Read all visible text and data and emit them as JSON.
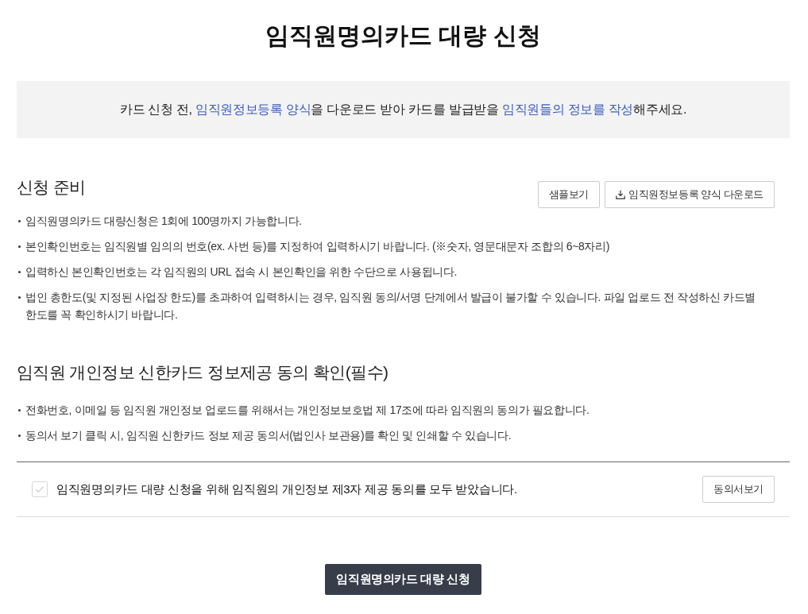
{
  "page_title": "임직원명의카드 대량 신청",
  "notice": {
    "segments": [
      {
        "text": "카드 신청 전, ",
        "highlighted": false
      },
      {
        "text": "임직원정보등록 양식",
        "highlighted": true
      },
      {
        "text": "을 다운로드 받아 카드를 발급받을 ",
        "highlighted": false
      },
      {
        "text": "임직원들의 정보를 작성",
        "highlighted": true
      },
      {
        "text": "해주세요.",
        "highlighted": false
      }
    ]
  },
  "sections": [
    {
      "heading": "신청 준비",
      "buttons": [
        {
          "label": "샘플보기",
          "icon": false
        },
        {
          "label": "임직원정보등록 양식 다운로드",
          "icon": true
        }
      ],
      "bullets": [
        "임직원명의카드 대량신청은 1회에 100명까지 가능합니다.",
        "본인확인번호는 임직원별 임의의 번호(ex. 사번 등)를 지정하여 입력하시기 바랍니다. (※숫자, 영문대문자 조합의 6~8자리)",
        "입력하신 본인확인번호는 각 임직원의 URL 접속 시 본인확인을 위한 수단으로 사용됩니다.",
        "법인 총한도(및 지정된 사업장 한도)를 초과하여 입력하시는 경우, 임직원 동의/서명 단계에서 발급이 불가할 수 있습니다. 파일 업로드 전 작성하신 카드별 한도를 꼭 확인하시기 바랍니다."
      ]
    },
    {
      "heading": "임직원 개인정보 신한카드 정보제공 동의 확인(필수)",
      "bullets": [
        "전화번호, 이메일 등 임직원 개인정보 업로드를 위해서는 개인정보보호법 제 17조에 따라 임직원의 동의가 필요합니다.",
        "동의서 보기 클릭 시, 임직원 신한카드 정보 제공 동의서(법인사 보관용)를 확인 및 인쇄할 수 있습니다."
      ]
    }
  ],
  "consent": {
    "checked": false,
    "label": "임직원명의카드 대량 신청을 위해 임직원의 개인정보 제3자 제공 동의를 모두 받았습니다.",
    "button": "동의서보기"
  },
  "submit_button": "임직원명의카드 대량 신청"
}
